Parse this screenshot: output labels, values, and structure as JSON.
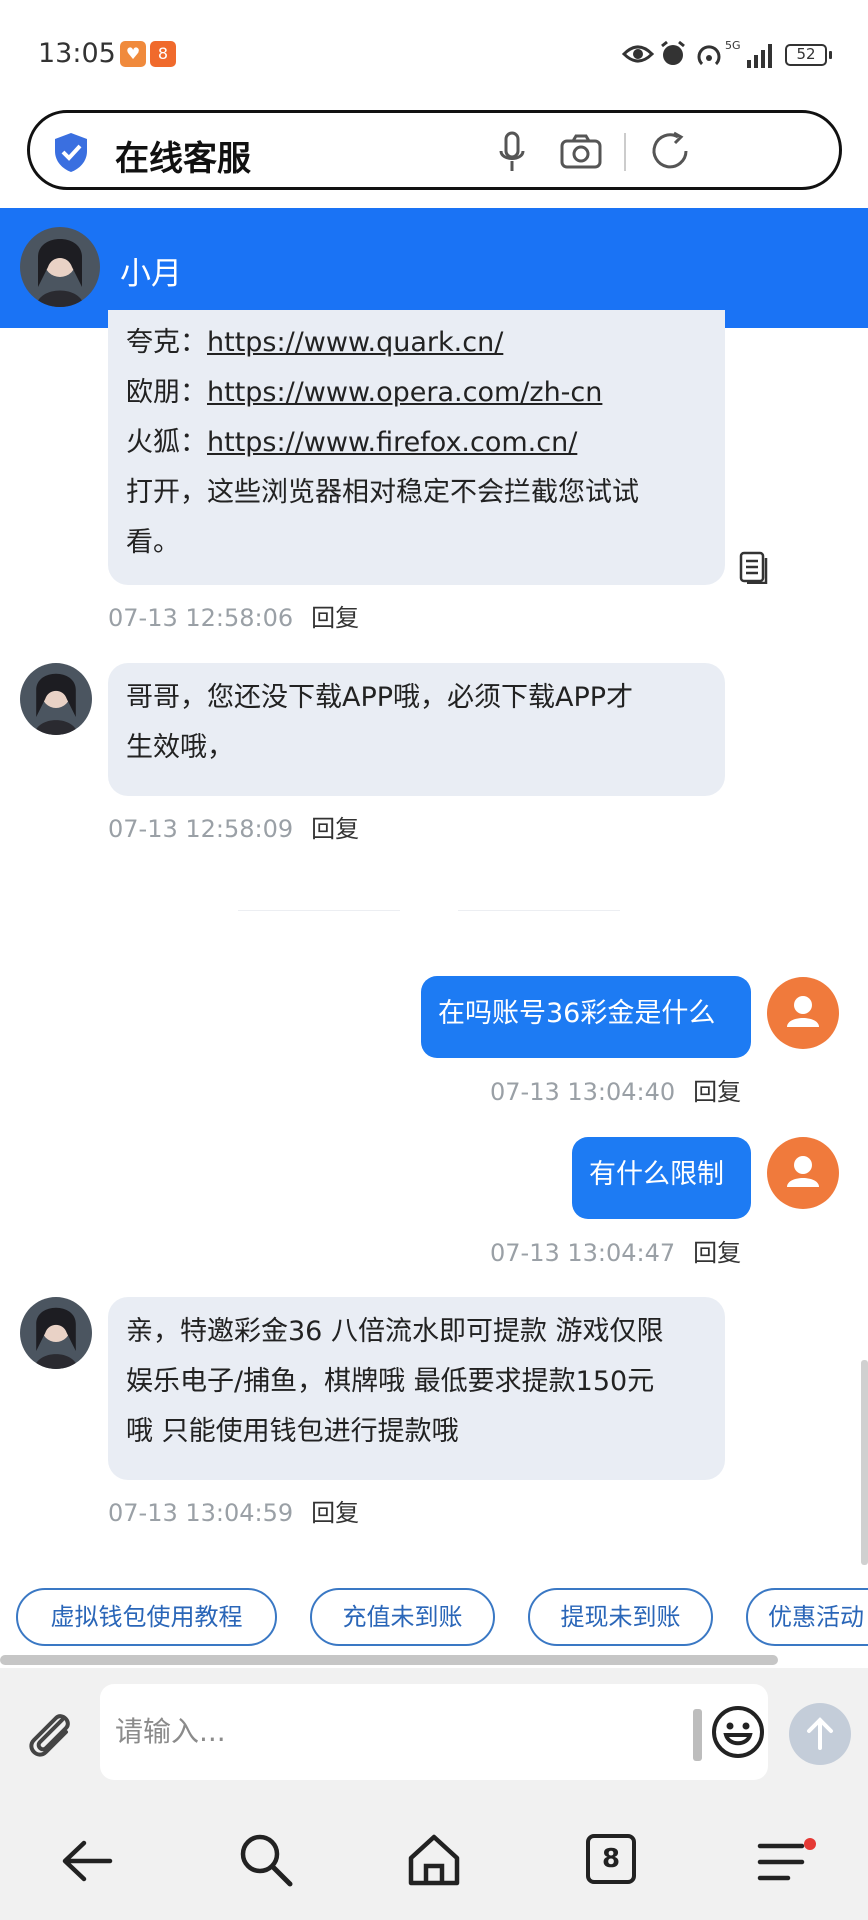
{
  "status_bar": {
    "time": "13:05",
    "network": "5G",
    "battery": "52"
  },
  "address_bar": {
    "title": "在线客服"
  },
  "chat_header": {
    "agent_name": "小月"
  },
  "messages": [
    {
      "from": "agent",
      "lines": [
        {
          "label": "夸克：",
          "link": "https://www.quark.cn/"
        },
        {
          "label": "欧朋：",
          "link": "https://www.opera.com/zh-cn"
        },
        {
          "label": "火狐：",
          "link": "https://www.firefox.com.cn/"
        },
        {
          "text": "打开，这些浏览器相对稳定不会拦截您试试"
        },
        {
          "text": "看。"
        }
      ],
      "time": "07-13 12:58:06",
      "reply": "回复"
    },
    {
      "from": "agent",
      "lines": [
        {
          "text": "哥哥，您还没下载APP哦，必须下载APP才"
        },
        {
          "text": "生效哦，"
        }
      ],
      "time": "07-13 12:58:09",
      "reply": "回复"
    },
    {
      "from": "user",
      "text": "在吗账号36彩金是什么",
      "time": "07-13 13:04:40",
      "reply": "回复"
    },
    {
      "from": "user",
      "text": "有什么限制",
      "time": "07-13 13:04:47",
      "reply": "回复"
    },
    {
      "from": "agent",
      "lines": [
        {
          "text": "亲，特邀彩金36 八倍流水即可提款 游戏仅限"
        },
        {
          "text": "娱乐电子/捕鱼，棋牌哦  最低要求提款150元"
        },
        {
          "text": "哦   只能使用钱包进行提款哦"
        }
      ],
      "time": "07-13 13:04:59",
      "reply": "回复"
    }
  ],
  "quick_replies": [
    "虚拟钱包使用教程",
    "充值未到账",
    "提现未到账",
    "优惠活动"
  ],
  "input": {
    "placeholder": "请输入..."
  },
  "bottom_nav": {
    "tab_count": "8"
  },
  "colors": {
    "header_blue": "#1a73f5",
    "user_bubble": "#1d7bf3",
    "agent_bubble": "#e9edf4",
    "user_avatar": "#f07a3c"
  }
}
